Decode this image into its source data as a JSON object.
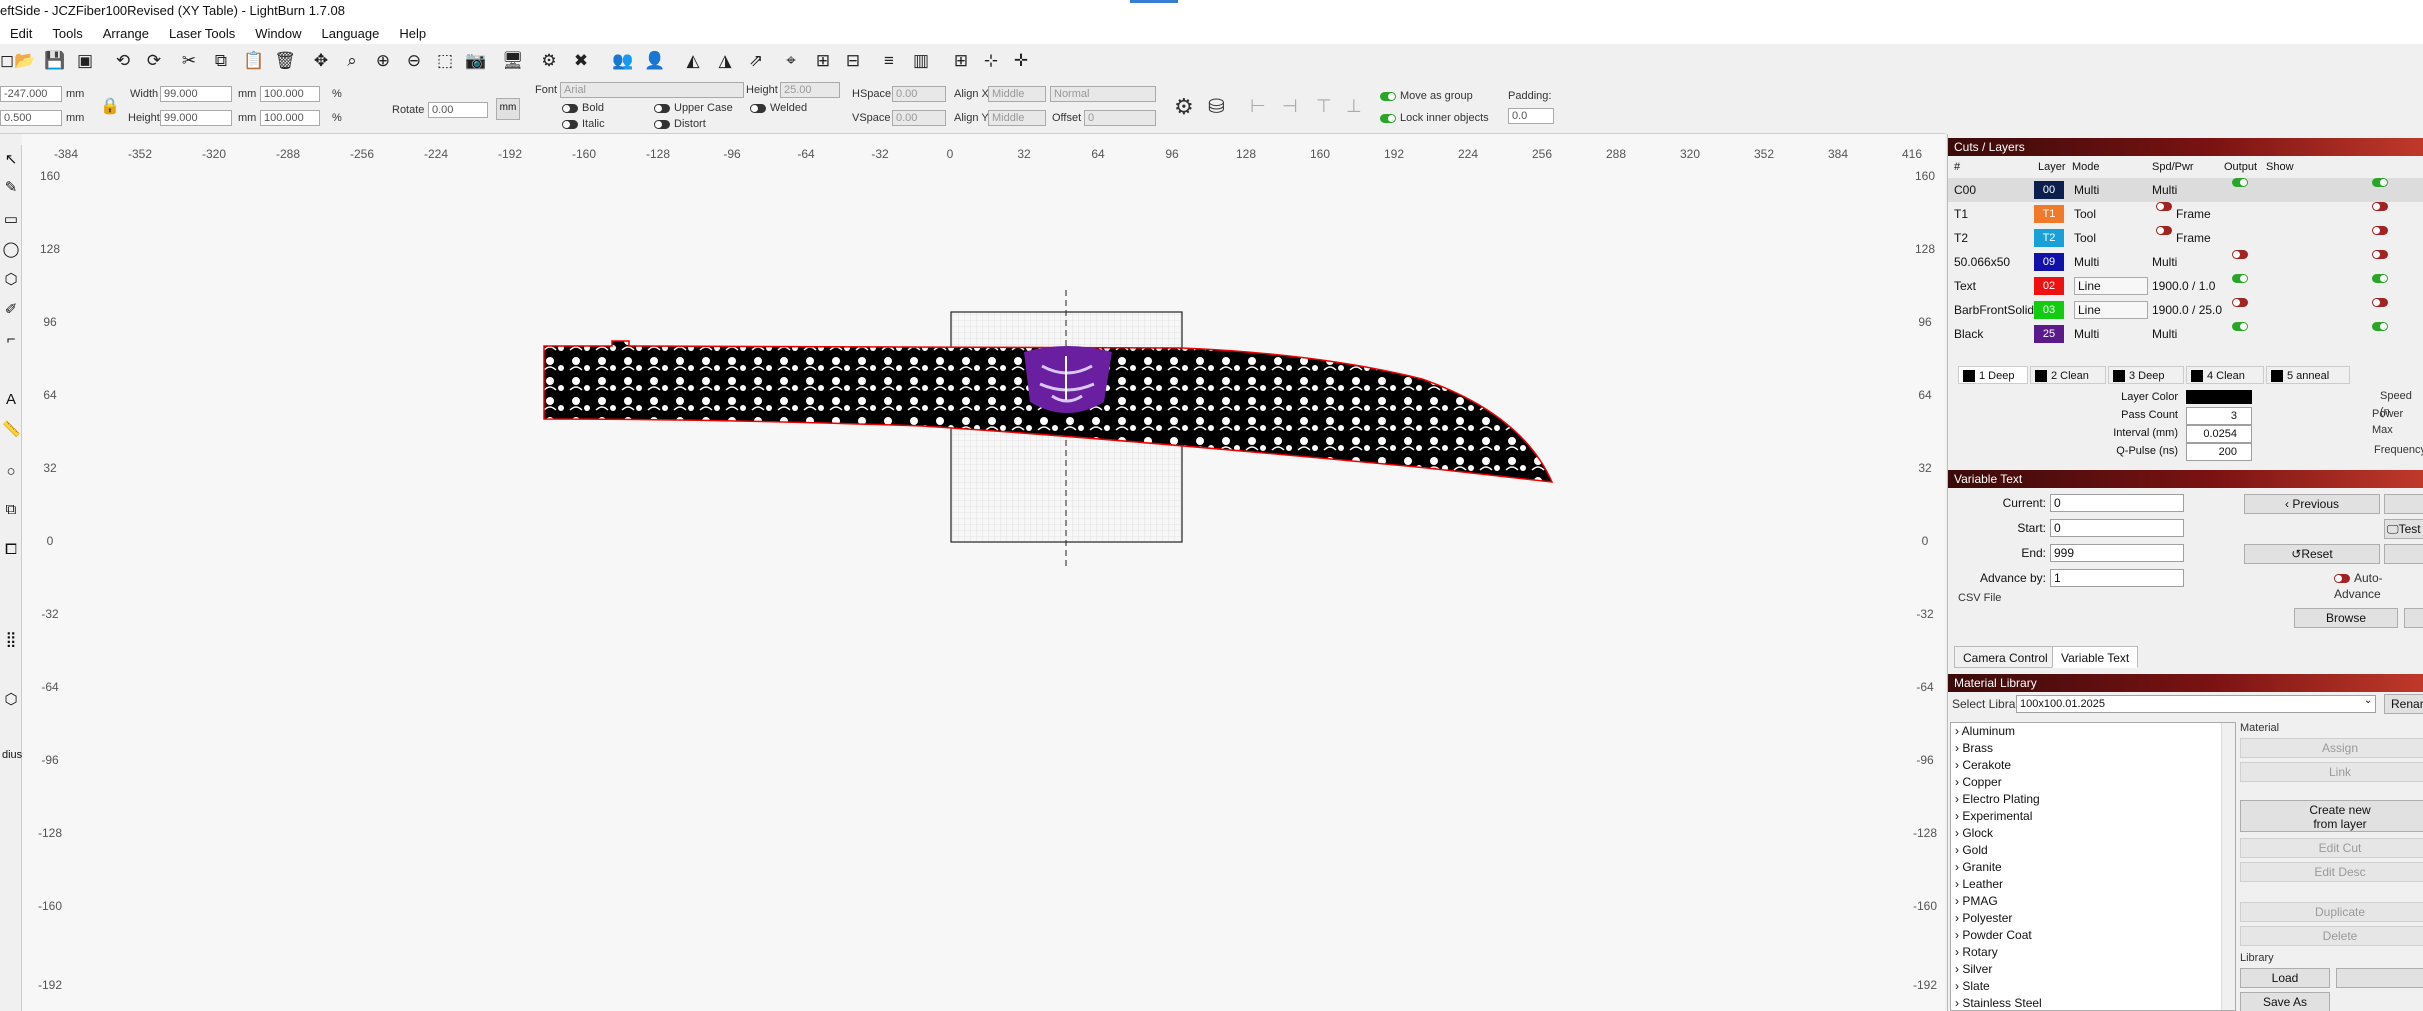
{
  "window": {
    "title": "eftSide - JCZFiber100Revised (XY Table) - LightBurn 1.7.08"
  },
  "menu": [
    "Edit",
    "Tools",
    "Arrange",
    "Laser Tools",
    "Window",
    "Language",
    "Help"
  ],
  "toolbar_icons": [
    "new-file-icon",
    "open-file-icon",
    "save-icon",
    "save-gcode-icon",
    "undo-icon",
    "redo-icon",
    "cut-icon",
    "copy-icon",
    "paste-icon",
    "delete-icon",
    "move-icon",
    "zoom-selection-icon",
    "zoom-in-icon",
    "zoom-out-icon",
    "frame-select-icon",
    "camera-icon",
    "monitor-icon",
    "tools-icon",
    "group-icon",
    "user-icon",
    "mirror-h-icon",
    "mirror-v-icon",
    "rotate-icon",
    "target-icon",
    "align-icon",
    "distribute-h-icon",
    "distribute-v-icon",
    "dock-icon",
    "grid-icon"
  ],
  "props": {
    "x_value": "-247.000",
    "y_value": "0.500",
    "width_label": "Width",
    "width_value": "99.000",
    "width_pct": "100.000",
    "height_label": "Height",
    "height_value": "99.000",
    "height_pct": "100.000",
    "unit": "mm",
    "pct": "%",
    "rotate_label": "Rotate",
    "rotate_value": "0.00",
    "mm_button": "mm",
    "font_label": "Font",
    "font_value": "Arial",
    "fheight_label": "Height",
    "fheight_value": "25.00",
    "hspace_label": "HSpace",
    "hspace_value": "0.00",
    "vspace_label": "VSpace",
    "vspace_value": "0.00",
    "alignx_label": "Align X",
    "alignx_value": "Middle",
    "aligny_label": "Align Y",
    "aligny_value": "Middle",
    "normal_value": "Normal",
    "offset_label": "Offset",
    "offset_value": "0",
    "bold": "Bold",
    "italic": "Italic",
    "upper_case": "Upper Case",
    "distort": "Distort",
    "welded": "Welded",
    "move_as_group": "Move as group",
    "lock_inner": "Lock inner objects",
    "padding_label": "Padding:",
    "padding_value": "0.0"
  },
  "ruler": {
    "x_ticks": [
      "-384",
      "-352",
      "-320",
      "-288",
      "-256",
      "-224",
      "-192",
      "-160",
      "-128",
      "-96",
      "-64",
      "-32",
      "0",
      "32",
      "64",
      "96",
      "128",
      "160",
      "192",
      "224",
      "256",
      "288",
      "320",
      "352",
      "384",
      "416"
    ],
    "y_ticks": [
      "160",
      "128",
      "96",
      "64",
      "32",
      "0",
      "-32",
      "-64",
      "-96",
      "-128",
      "-160",
      "-192"
    ]
  },
  "left_tools": [
    "select-icon",
    "edit-nodes-icon",
    "rectangle-icon",
    "ellipse-icon",
    "polygon-icon",
    "pen-icon",
    "line-icon",
    "text-icon",
    "measure-icon",
    "circle-tool-icon",
    "copy-along-icon",
    "grid-array-icon",
    "boolean-icon"
  ],
  "left_label": "dius:",
  "cuts": {
    "title": "Cuts / Layers",
    "headers": [
      "#",
      "Layer",
      "Mode",
      "Spd/Pwr",
      "Output",
      "Show"
    ],
    "rows": [
      {
        "name": "C00",
        "chip": "00",
        "color": "#0b1f4f",
        "mode": "Multi",
        "spd": "Multi",
        "output": "on",
        "show": "on"
      },
      {
        "name": "T1",
        "chip": "T1",
        "color": "#f07a2a",
        "mode": "Tool",
        "spd": "Frame",
        "output": "",
        "show": "red"
      },
      {
        "name": "T2",
        "chip": "T2",
        "color": "#1aa0d8",
        "mode": "Tool",
        "spd": "Frame",
        "output": "",
        "show": "red"
      },
      {
        "name": "50.066x50",
        "chip": "09",
        "color": "#1111aa",
        "mode": "Multi",
        "spd": "Multi",
        "output": "red",
        "show": "red"
      },
      {
        "name": "Text",
        "chip": "02",
        "color": "#ee1111",
        "mode": "Line",
        "spd": "1900.0 / 1.0",
        "output": "on",
        "show": "on"
      },
      {
        "name": "BarbFrontSolid",
        "chip": "03",
        "color": "#11cc11",
        "mode": "Line",
        "spd": "1900.0 / 25.0",
        "output": "red",
        "show": "red"
      },
      {
        "name": "Black",
        "chip": "25",
        "color": "#5a1a8a",
        "mode": "Multi",
        "spd": "Multi",
        "output": "on",
        "show": "on"
      }
    ],
    "subtabs": [
      "1 Deep",
      "2 Clean",
      "3 Deep",
      "4 Clean",
      "5 anneal"
    ],
    "layer_color_label": "Layer Color",
    "pass_count_label": "Pass Count",
    "pass_count": "3",
    "interval_label": "Interval (mm)",
    "interval": "0.0254",
    "qpulse_label": "Q-Pulse (ns)",
    "qpulse": "200",
    "speed_label": "Speed (n",
    "power_label": "Power Max",
    "frequency_label": "Frequency"
  },
  "vartext": {
    "title": "Variable Text",
    "current_label": "Current:",
    "current": "0",
    "start_label": "Start:",
    "start": "0",
    "end_label": "End:",
    "end": "999",
    "advance_label": "Advance by:",
    "advance": "1",
    "previous": "Previous",
    "test": "Test",
    "reset": "Reset",
    "auto_advance": "Auto-Advance",
    "csv_label": "CSV File",
    "browse": "Browse"
  },
  "bottom_tabs": [
    "Camera Control",
    "Variable Text"
  ],
  "material": {
    "title": "Material Library",
    "select_label": "Select Library",
    "library": "100x100.01.2025",
    "rename": "Renan",
    "items": [
      "Aluminum",
      "Brass",
      "Cerakote",
      "Copper",
      "Electro Plating",
      "Experimental",
      "Glock",
      "Gold",
      "Granite",
      "Leather",
      "PMAG",
      "Polyester",
      "Powder Coat",
      "Rotary",
      "Silver",
      "Slate",
      "Stainless Steel"
    ],
    "material_group": "Material",
    "assign": "Assign",
    "link": "Link",
    "create_new": "Create new",
    "from_layer": "from layer",
    "edit_cut": "Edit Cut",
    "edit_desc": "Edit Desc",
    "duplicate": "Duplicate",
    "delete": "Delete",
    "library_group": "Library",
    "load": "Load",
    "save_as": "Save As"
  }
}
